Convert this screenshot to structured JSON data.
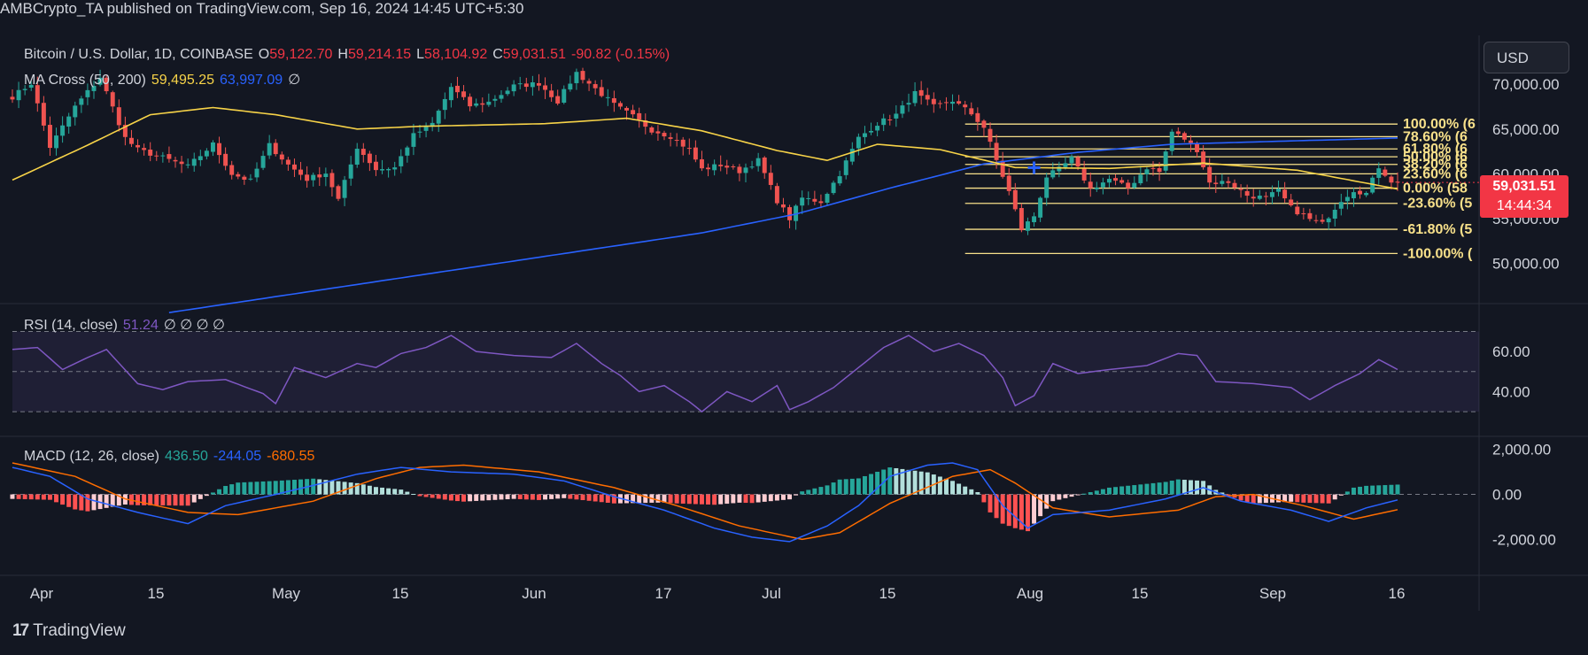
{
  "header": {
    "published": "AMBCrypto_TA published on TradingView.com, Sep 16, 2024 14:45 UTC+5:30"
  },
  "legend": {
    "symbol": "Bitcoin / U.S. Dollar, 1D, COINBASE",
    "o_label": "O",
    "o_value": "59,122.70",
    "h_label": "H",
    "h_value": "59,214.15",
    "l_label": "L",
    "l_value": "58,104.92",
    "c_label": "C",
    "c_value": "59,031.51",
    "change": "-90.82 (-0.15%)",
    "ma_label": "MA Cross (50, 200)",
    "ma_fast": "59,495.25",
    "ma_slow": "63,997.09",
    "ma_extra": "∅",
    "rsi_label": "RSI (14, close)",
    "rsi_value": "51.24",
    "rsi_extra": "∅ ∅ ∅ ∅",
    "macd_label": "MACD (12, 26, close)",
    "macd_value": "436.50",
    "macd_signal": "-244.05",
    "macd_hist": "-680.55"
  },
  "currency_button": "USD",
  "price_tag": {
    "price": "59,031.51",
    "countdown": "14:44:34"
  },
  "brand": {
    "logo": "17",
    "name": "TradingView"
  },
  "fib_labels": [
    "100.00% (6",
    "78.60% (6",
    "61.80% (6",
    "50.00% (6",
    "38.20% (6",
    "23.60% (6",
    "0.00% (58",
    "-23.60% (5",
    "-61.80% (5",
    "-100.00% ("
  ],
  "colors": {
    "background": "#131722",
    "up": "#26a69a",
    "down": "#ef5350",
    "ma_fast": "#f7d348",
    "ma_slow": "#2962ff",
    "rsi": "#7e57c2",
    "macd_line": "#2962ff",
    "signal_line": "#ff6d00",
    "fib": "#f7e08a",
    "price_tag": "#f23645"
  },
  "chart_data": {
    "type": "candlestick",
    "x_ticks": [
      "Apr",
      "15",
      "May",
      "15",
      "Jun",
      "17",
      "Jul",
      "15",
      "Aug",
      "15",
      "Sep",
      "16"
    ],
    "price_axis": {
      "ticks": [
        "70,000.00",
        "65,000.00",
        "60,000.00",
        "55,000.00",
        "50,000.00"
      ],
      "range": [
        45800,
        71700
      ]
    },
    "rsi_axis": {
      "ticks": [
        "60.00",
        "40.00"
      ],
      "range": [
        19,
        83
      ]
    },
    "macd_axis": {
      "ticks": [
        "2,000.00",
        "0.00",
        "-2,000.00"
      ],
      "range": [
        -3400,
        2500
      ]
    },
    "price_keypoints": [
      [
        0,
        68600
      ],
      [
        3,
        70100
      ],
      [
        6,
        63000
      ],
      [
        10,
        67500
      ],
      [
        14,
        70800
      ],
      [
        18,
        64000
      ],
      [
        20,
        62700
      ],
      [
        24,
        61800
      ],
      [
        28,
        60800
      ],
      [
        32,
        63300
      ],
      [
        35,
        60000
      ],
      [
        38,
        59200
      ],
      [
        41,
        63200
      ],
      [
        44,
        61000
      ],
      [
        47,
        59400
      ],
      [
        50,
        60100
      ],
      [
        52,
        57100
      ],
      [
        55,
        63000
      ],
      [
        58,
        60500
      ],
      [
        61,
        60700
      ],
      [
        64,
        64300
      ],
      [
        67,
        65600
      ],
      [
        70,
        69700
      ],
      [
        73,
        67600
      ],
      [
        76,
        68000
      ],
      [
        80,
        69800
      ],
      [
        84,
        70100
      ],
      [
        87,
        68100
      ],
      [
        90,
        71300
      ],
      [
        93,
        69500
      ],
      [
        96,
        67700
      ],
      [
        99,
        66400
      ],
      [
        102,
        64900
      ],
      [
        105,
        64200
      ],
      [
        108,
        62700
      ],
      [
        110,
        60500
      ],
      [
        113,
        61000
      ],
      [
        116,
        60300
      ],
      [
        119,
        61500
      ],
      [
        122,
        57000
      ],
      [
        124,
        55000
      ],
      [
        126,
        57300
      ],
      [
        129,
        56900
      ],
      [
        132,
        60000
      ],
      [
        135,
        64000
      ],
      [
        138,
        65600
      ],
      [
        141,
        66600
      ],
      [
        144,
        69000
      ],
      [
        147,
        67500
      ],
      [
        150,
        68200
      ],
      [
        153,
        66700
      ],
      [
        155,
        65200
      ],
      [
        157,
        61500
      ],
      [
        159,
        58000
      ],
      [
        161,
        53800
      ],
      [
        163,
        55300
      ],
      [
        165,
        59700
      ],
      [
        167,
        60500
      ],
      [
        169,
        61700
      ],
      [
        172,
        58300
      ],
      [
        175,
        59400
      ],
      [
        178,
        58400
      ],
      [
        181,
        60700
      ],
      [
        183,
        60200
      ],
      [
        185,
        64700
      ],
      [
        187,
        63900
      ],
      [
        189,
        62700
      ],
      [
        191,
        59000
      ],
      [
        194,
        59100
      ],
      [
        197,
        57600
      ],
      [
        200,
        57300
      ],
      [
        202,
        58100
      ],
      [
        204,
        56200
      ],
      [
        207,
        54900
      ],
      [
        209,
        54400
      ],
      [
        212,
        57100
      ],
      [
        214,
        58200
      ],
      [
        216,
        57800
      ],
      [
        218,
        60800
      ],
      [
        220,
        59200
      ],
      [
        221,
        59031
      ]
    ],
    "ma50_keypoints": [
      [
        0,
        59300
      ],
      [
        12,
        63200
      ],
      [
        22,
        66600
      ],
      [
        32,
        67400
      ],
      [
        42,
        66600
      ],
      [
        55,
        65000
      ],
      [
        65,
        65300
      ],
      [
        85,
        65600
      ],
      [
        98,
        66200
      ],
      [
        110,
        64800
      ],
      [
        122,
        62600
      ],
      [
        130,
        61500
      ],
      [
        138,
        63300
      ],
      [
        148,
        62700
      ],
      [
        160,
        60700
      ],
      [
        175,
        60600
      ],
      [
        190,
        61200
      ],
      [
        205,
        60400
      ],
      [
        221,
        58300
      ]
    ],
    "ma200_keypoints": [
      [
        25,
        44500
      ],
      [
        110,
        53400
      ],
      [
        125,
        55500
      ],
      [
        140,
        58400
      ],
      [
        155,
        61100
      ],
      [
        170,
        62400
      ],
      [
        185,
        63300
      ],
      [
        221,
        64000
      ]
    ],
    "fibonacci": {
      "levels": [
        "100.00%",
        "78.60%",
        "61.80%",
        "50.00%",
        "38.20%",
        "23.60%",
        "0.00%",
        "-23.60%",
        "-61.80%",
        "-100.00%"
      ],
      "prices": [
        65550,
        64150,
        62780,
        61900,
        61050,
        60000,
        58400,
        56700,
        53800,
        51100
      ]
    },
    "rsi_keypoints": [
      [
        0,
        61
      ],
      [
        4,
        62
      ],
      [
        8,
        51
      ],
      [
        12,
        57
      ],
      [
        15,
        61
      ],
      [
        20,
        44
      ],
      [
        24,
        41
      ],
      [
        28,
        45
      ],
      [
        34,
        46
      ],
      [
        40,
        39
      ],
      [
        42,
        34
      ],
      [
        45,
        52
      ],
      [
        50,
        47
      ],
      [
        55,
        54
      ],
      [
        58,
        52
      ],
      [
        62,
        59
      ],
      [
        66,
        62
      ],
      [
        70,
        68
      ],
      [
        74,
        60
      ],
      [
        80,
        58
      ],
      [
        86,
        57
      ],
      [
        90,
        64
      ],
      [
        94,
        54
      ],
      [
        97,
        48
      ],
      [
        100,
        40
      ],
      [
        104,
        43
      ],
      [
        108,
        35
      ],
      [
        110,
        30
      ],
      [
        114,
        40
      ],
      [
        118,
        35
      ],
      [
        122,
        43
      ],
      [
        124,
        31
      ],
      [
        127,
        35
      ],
      [
        131,
        42
      ],
      [
        135,
        52
      ],
      [
        139,
        62
      ],
      [
        143,
        68
      ],
      [
        147,
        60
      ],
      [
        151,
        64
      ],
      [
        155,
        58
      ],
      [
        158,
        47
      ],
      [
        160,
        33
      ],
      [
        163,
        38
      ],
      [
        166,
        54
      ],
      [
        170,
        49
      ],
      [
        175,
        51
      ],
      [
        181,
        53
      ],
      [
        186,
        59
      ],
      [
        189,
        58
      ],
      [
        192,
        45
      ],
      [
        198,
        44
      ],
      [
        204,
        42
      ],
      [
        207,
        36
      ],
      [
        211,
        43
      ],
      [
        215,
        49
      ],
      [
        218,
        56
      ],
      [
        221,
        51
      ]
    ],
    "macd_keypoints": [
      [
        0,
        1200
      ],
      [
        6,
        800
      ],
      [
        12,
        -200
      ],
      [
        20,
        -800
      ],
      [
        28,
        -1300
      ],
      [
        34,
        -500
      ],
      [
        42,
        0
      ],
      [
        48,
        400
      ],
      [
        55,
        900
      ],
      [
        62,
        1200
      ],
      [
        70,
        1000
      ],
      [
        80,
        900
      ],
      [
        88,
        600
      ],
      [
        96,
        -100
      ],
      [
        104,
        -700
      ],
      [
        112,
        -1500
      ],
      [
        118,
        -1900
      ],
      [
        124,
        -2100
      ],
      [
        130,
        -1400
      ],
      [
        135,
        -500
      ],
      [
        140,
        800
      ],
      [
        146,
        1300
      ],
      [
        150,
        1400
      ],
      [
        154,
        1100
      ],
      [
        158,
        -500
      ],
      [
        162,
        -1500
      ],
      [
        166,
        -900
      ],
      [
        175,
        -700
      ],
      [
        184,
        -200
      ],
      [
        190,
        300
      ],
      [
        196,
        -300
      ],
      [
        204,
        -700
      ],
      [
        210,
        -1200
      ],
      [
        216,
        -600
      ],
      [
        221,
        -244
      ]
    ],
    "signal_keypoints": [
      [
        0,
        1400
      ],
      [
        10,
        800
      ],
      [
        18,
        -200
      ],
      [
        28,
        -800
      ],
      [
        36,
        -900
      ],
      [
        48,
        -300
      ],
      [
        58,
        700
      ],
      [
        65,
        1200
      ],
      [
        72,
        1300
      ],
      [
        84,
        1000
      ],
      [
        96,
        300
      ],
      [
        106,
        -500
      ],
      [
        116,
        -1400
      ],
      [
        126,
        -2000
      ],
      [
        132,
        -1700
      ],
      [
        140,
        -400
      ],
      [
        150,
        800
      ],
      [
        156,
        1100
      ],
      [
        160,
        500
      ],
      [
        166,
        -600
      ],
      [
        175,
        -1000
      ],
      [
        186,
        -700
      ],
      [
        192,
        -100
      ],
      [
        198,
        0
      ],
      [
        206,
        -500
      ],
      [
        214,
        -1100
      ],
      [
        221,
        -680
      ]
    ]
  }
}
